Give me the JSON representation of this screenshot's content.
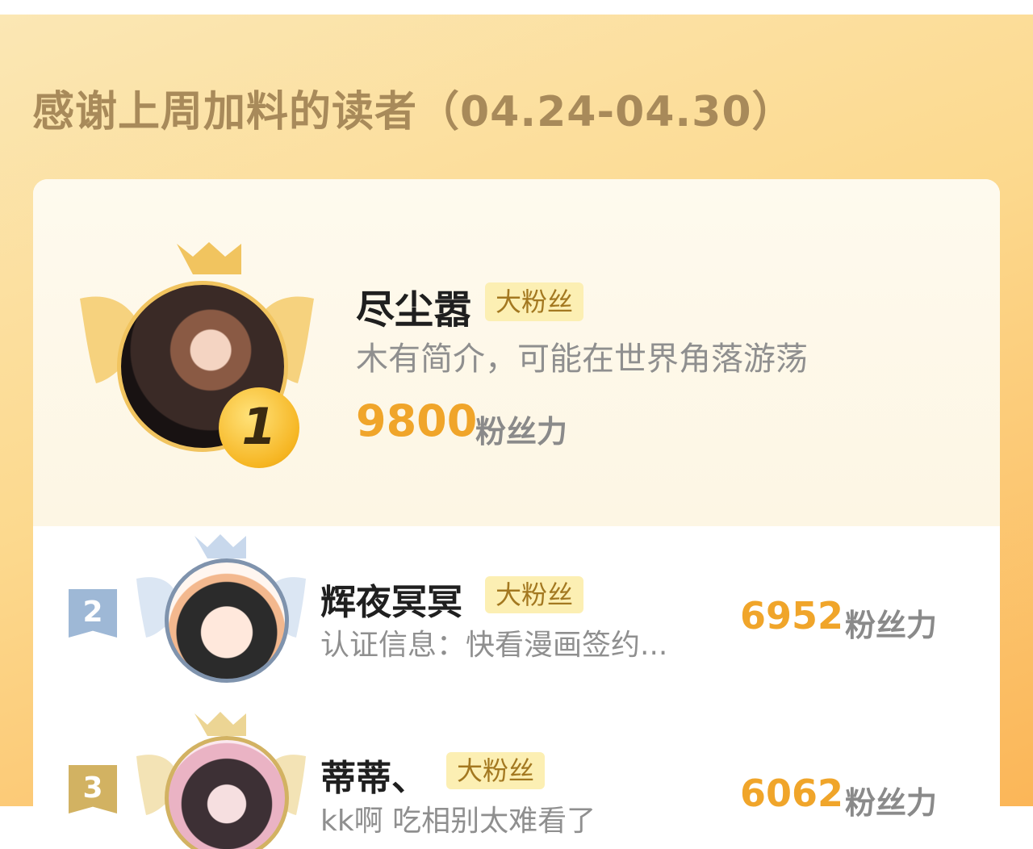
{
  "header": {
    "title": "感谢上周加料的读者（04.24-04.30）"
  },
  "ranking": [
    {
      "rank": "1",
      "name": "尽尘嚣",
      "tag": "大粉丝",
      "desc": "木有简介，可能在世界角落游荡",
      "score": "9800",
      "unit": "粉丝力"
    },
    {
      "rank": "2",
      "name": "辉夜冥冥",
      "tag": "大粉丝",
      "desc": "认证信息：快看漫画签约...",
      "score": "6952",
      "unit": "粉丝力"
    },
    {
      "rank": "3",
      "name": "蒂蒂、",
      "tag": "大粉丝",
      "desc": "kk啊 吃相别太难看了",
      "score": "6062",
      "unit": "粉丝力"
    }
  ],
  "colors": {
    "gold": "#f1c45f",
    "silver": "#9eb8d6",
    "bronze": "#d2b262",
    "score": "#f0a52a"
  }
}
